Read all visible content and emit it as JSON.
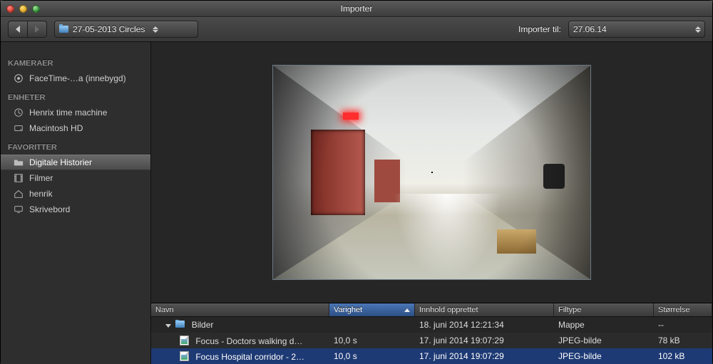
{
  "window": {
    "title": "Importer"
  },
  "toolbar": {
    "path_folder": "27-05-2013 Circles",
    "import_to_label": "Importer til:",
    "import_to_value": "27.06.14"
  },
  "sidebar": {
    "sections": [
      {
        "header": "KAMERAER",
        "items": [
          {
            "icon": "camera",
            "label": "FaceTime-…a (innebygd)",
            "selected": false
          }
        ]
      },
      {
        "header": "ENHETER",
        "items": [
          {
            "icon": "timemachine",
            "label": "Henrix time machine"
          },
          {
            "icon": "hdd",
            "label": "Macintosh HD"
          }
        ]
      },
      {
        "header": "FAVORITTER",
        "items": [
          {
            "icon": "folder",
            "label": "Digitale Historier",
            "selected": true
          },
          {
            "icon": "film",
            "label": "Filmer"
          },
          {
            "icon": "home",
            "label": "henrik"
          },
          {
            "icon": "desktop",
            "label": "Skrivebord"
          }
        ]
      }
    ]
  },
  "columns": {
    "name": "Navn",
    "dur": "Varighet",
    "date": "Innhold opprettet",
    "type": "Filtype",
    "size": "Størrelse",
    "sorted": "dur",
    "sort_dir": "asc"
  },
  "rows": [
    {
      "kind": "folder",
      "name": "Bilder",
      "dur": "",
      "date": "18. juni 2014 12:21:34",
      "type": "Mappe",
      "size": "--",
      "expanded": true
    },
    {
      "kind": "image",
      "name": "Focus - Doctors walking d…",
      "dur": "10,0 s",
      "date": "17. juni 2014 19:07:29",
      "type": "JPEG-bilde",
      "size": "78 kB"
    },
    {
      "kind": "image",
      "name": "Focus Hospital corridor - 2…",
      "dur": "10,0 s",
      "date": "17. juni 2014 19:07:29",
      "type": "JPEG-bilde",
      "size": "102 kB",
      "selected": true
    }
  ],
  "preview": {
    "alt": "Hospital corridor"
  }
}
